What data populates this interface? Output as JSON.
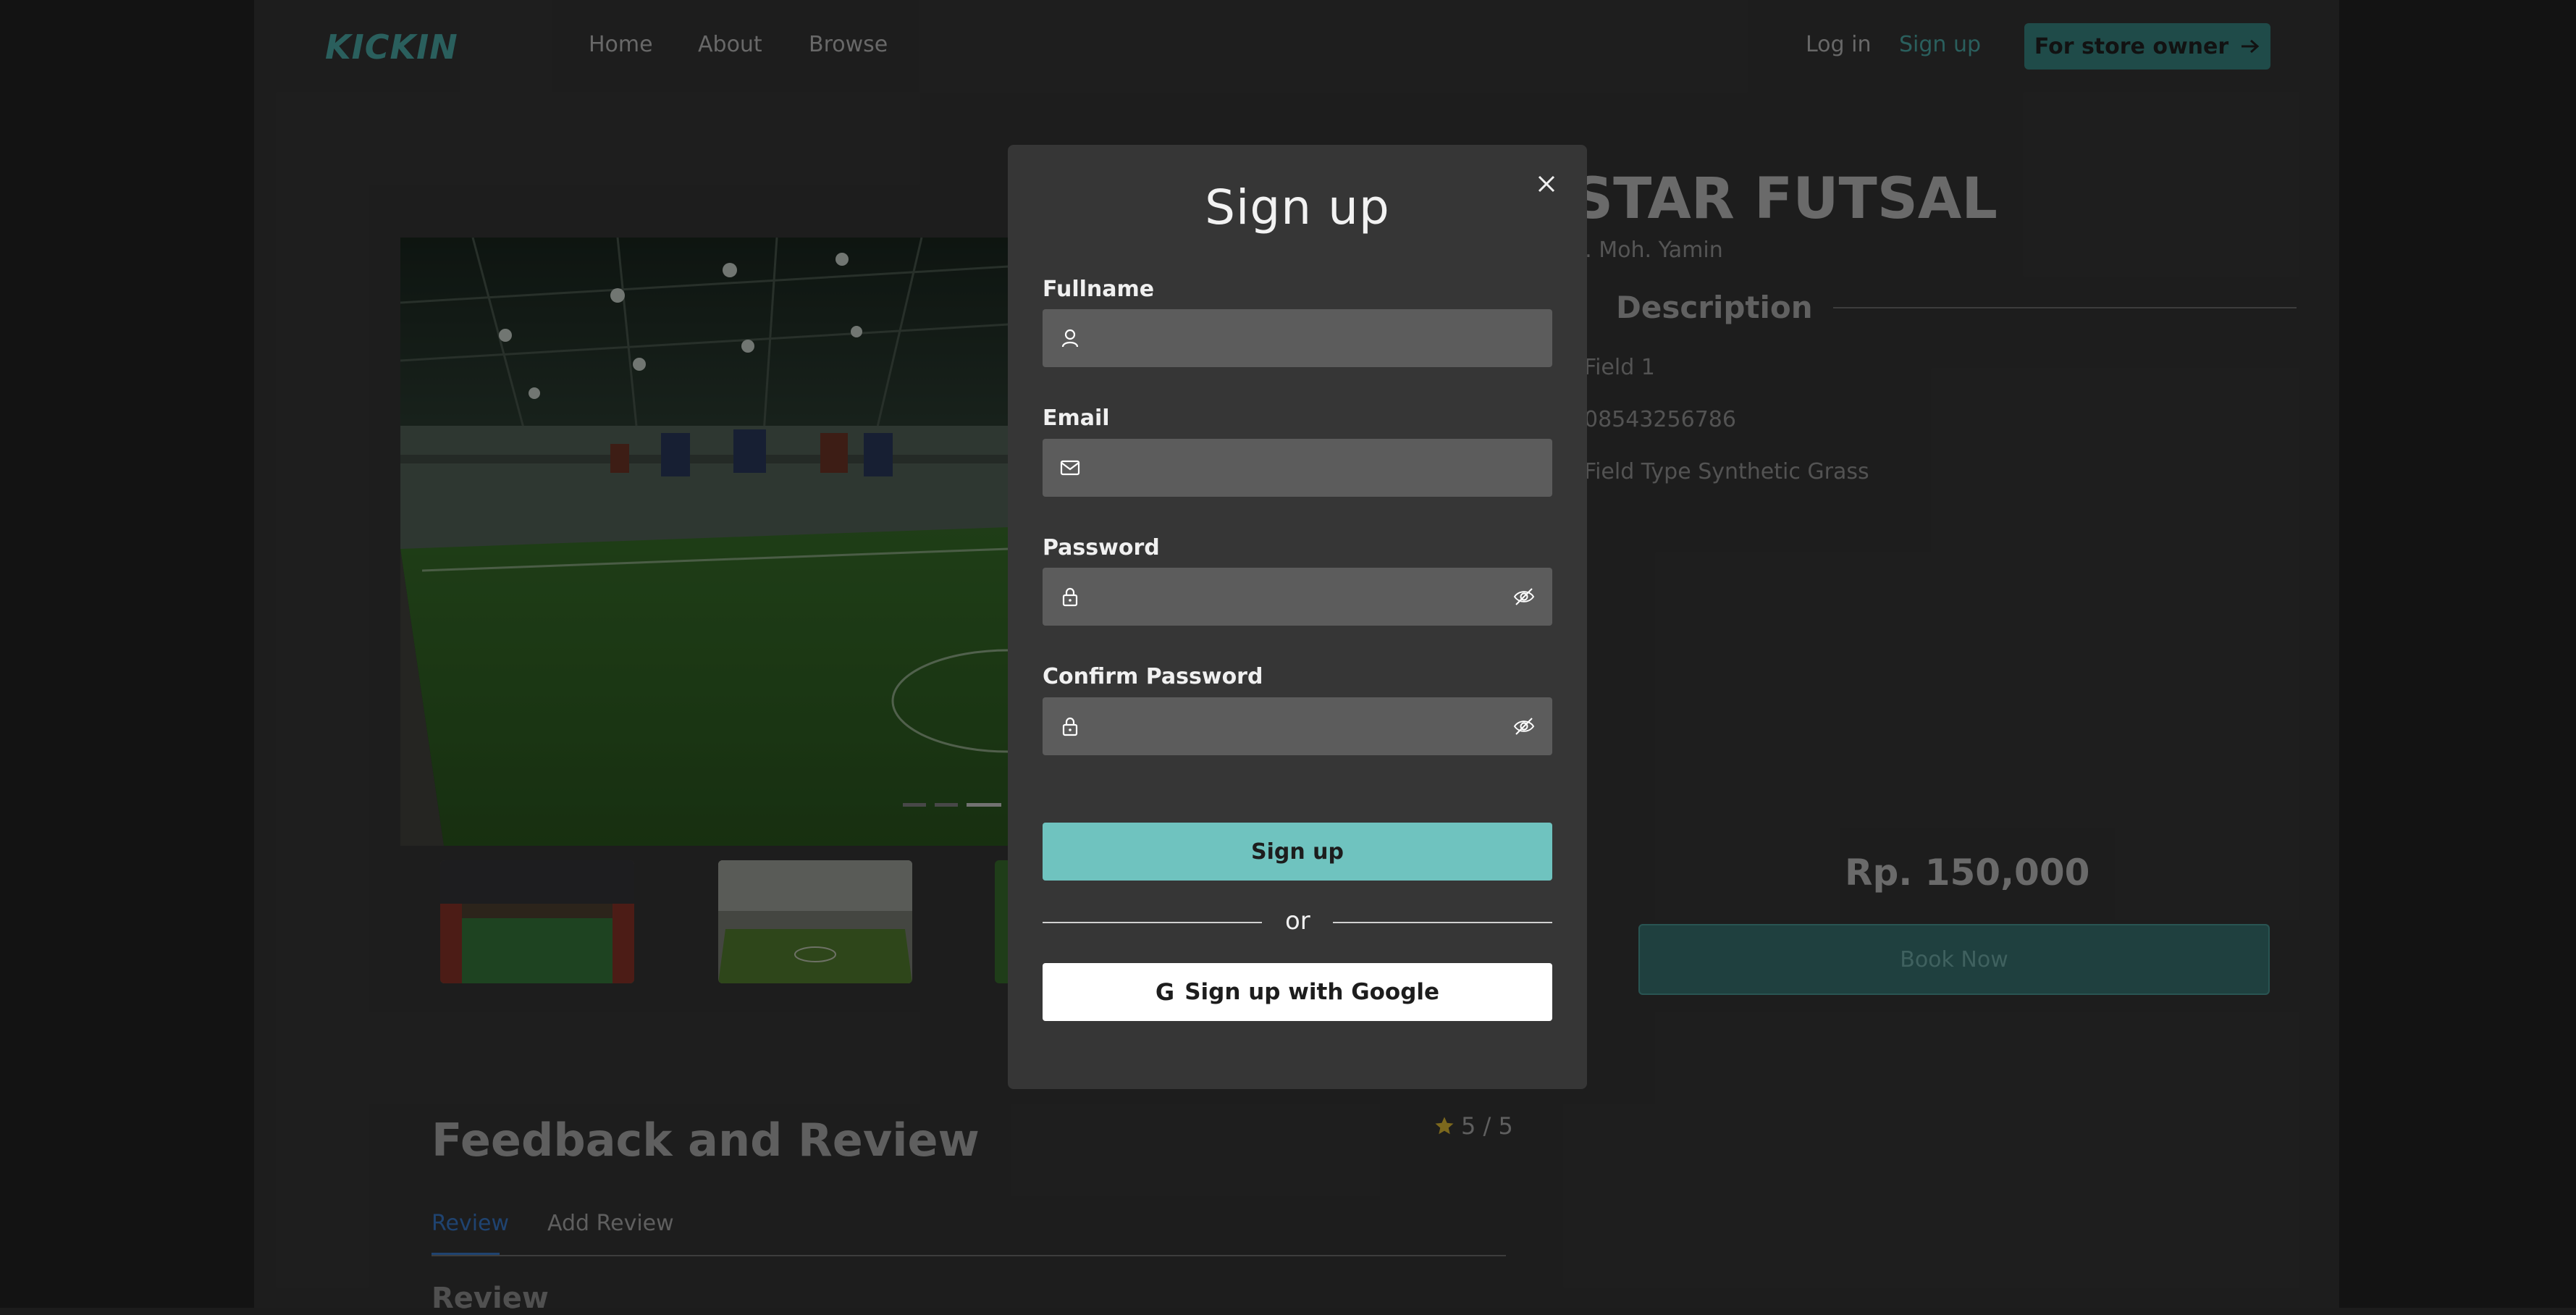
{
  "nav": {
    "logo": "KICKIN",
    "links": [
      "Home",
      "About",
      "Browse"
    ],
    "login": "Log in",
    "signup": "Sign up",
    "store_owner": "For store owner"
  },
  "venue": {
    "title": "STAR FUTSAL",
    "address": "Jl. Moh. Yamin",
    "description_heading": "Description",
    "info": [
      "Field 1",
      "08543256786",
      "Field Type Synthetic Grass"
    ],
    "price": "Rp. 150,000",
    "book_label": "Book Now"
  },
  "feedback": {
    "title": "Feedback and Review",
    "rating": "5 / 5",
    "tabs": [
      "Review",
      "Add Review"
    ],
    "subheading": "Review"
  },
  "modal": {
    "title": "Sign up",
    "fields": {
      "fullname": {
        "label": "Fullname",
        "value": ""
      },
      "email": {
        "label": "Email",
        "value": ""
      },
      "password": {
        "label": "Password",
        "value": ""
      },
      "confirm": {
        "label": "Confirm Password",
        "value": ""
      }
    },
    "submit": "Sign up",
    "or": "or",
    "google": "Sign up with Google"
  },
  "colors": {
    "accent": "#3f8c89",
    "button": "#6fc3bf",
    "tab_active": "#2f64a6",
    "star": "#b79a2b"
  }
}
